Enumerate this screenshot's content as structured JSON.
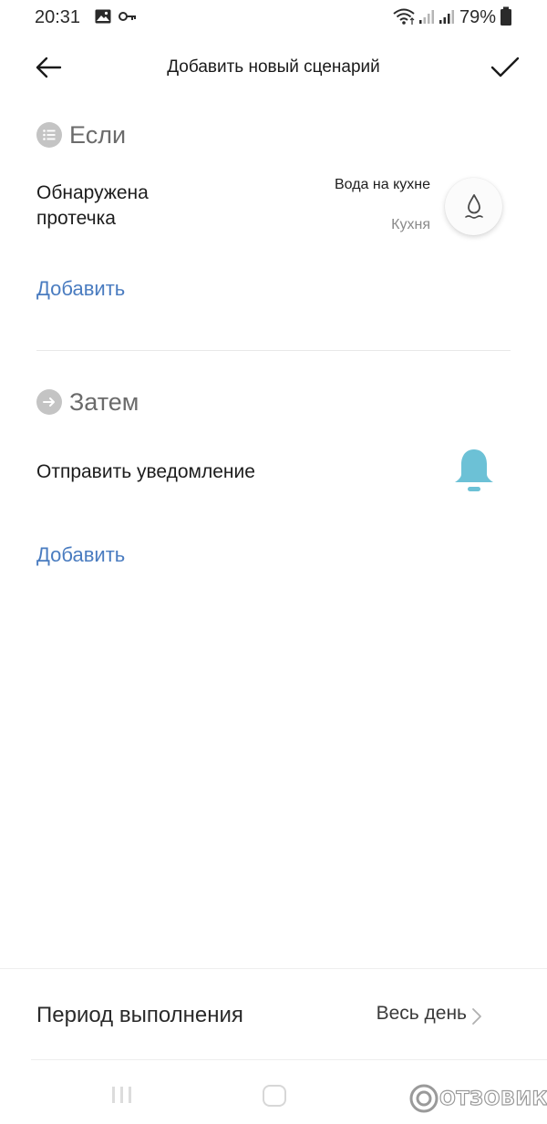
{
  "status_bar": {
    "time": "20:31",
    "battery": "79%",
    "icons": [
      "image-icon",
      "key-icon",
      "wifi-icon",
      "signal-icon",
      "signal-icon",
      "battery-icon"
    ]
  },
  "header": {
    "title": "Добавить новый сценарий",
    "back_icon": "arrow-left-icon",
    "confirm_icon": "checkmark-icon"
  },
  "if_section": {
    "title": "Если",
    "icon": "list-icon",
    "condition": {
      "label": "Обнаружена протечка",
      "device_name": "Вода на кухне",
      "device_room": "Кухня",
      "device_icon": "water-drop-icon"
    },
    "add_label": "Добавить"
  },
  "then_section": {
    "title": "Затем",
    "icon": "arrow-right-icon",
    "action": {
      "label": "Отправить уведомление",
      "icon": "bell-icon",
      "icon_color": "#6cc1d6"
    },
    "add_label": "Добавить"
  },
  "period": {
    "label": "Период выполнения",
    "value": "Весь день"
  },
  "watermark": "ОТЗОВИК",
  "colors": {
    "accent_link": "#4a7cc0",
    "section_icon_bg": "#c4c4c4",
    "bell": "#6cc1d6"
  }
}
